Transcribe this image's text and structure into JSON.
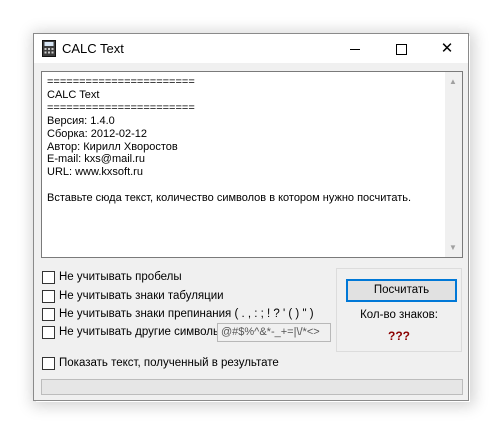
{
  "window": {
    "title": "CALC Text",
    "controls": {
      "minimize": "minimize",
      "maximize": "maximize",
      "close": "✕"
    }
  },
  "text_area": {
    "content": "=======================\nCALC Text\n=======================\nВерсия: 1.4.0\nСборка: 2012-02-12\nАвтор: Кирилл Хворостов\nE-mail: kxs@mail.ru\nURL: www.kxsoft.ru\n\nВставьте сюда текст, количество символов в котором нужно посчитать."
  },
  "options": {
    "ignore_spaces": {
      "label": "Не учитывать пробелы",
      "checked": false
    },
    "ignore_tabs": {
      "label": "Не учитывать знаки табуляции",
      "checked": false
    },
    "ignore_punct": {
      "label": "Не учитывать знаки препинания ( . , : ; ! ? ' ( ) \" )",
      "checked": false
    },
    "ignore_other": {
      "label": "Не учитывать другие символы",
      "checked": false,
      "value": "@#$%^&*-_+=|\\/*<>"
    },
    "show_result_text": {
      "label": "Показать текст, полученный в результате",
      "checked": false
    }
  },
  "count_panel": {
    "button_label": "Посчитать",
    "count_label": "Кол-во знаков:",
    "count_value": "???"
  },
  "progress": {
    "value": 0
  }
}
